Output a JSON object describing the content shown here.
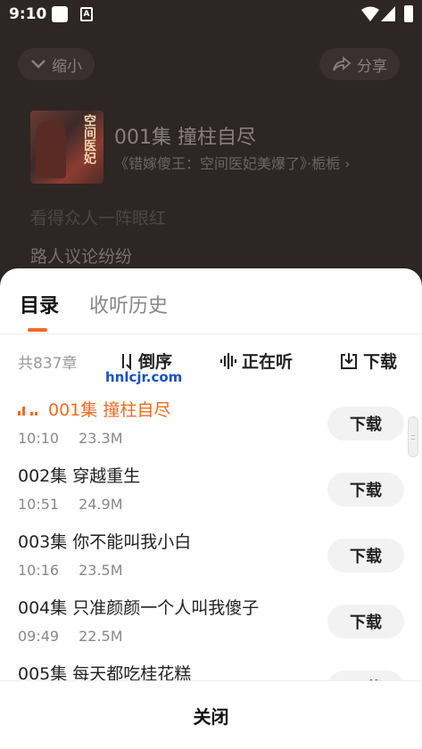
{
  "status_bar": {
    "time": "9:10",
    "notification_icon_letter": "A"
  },
  "player": {
    "collapse_label": "缩小",
    "share_label": "分享",
    "episode_title": "001集 撞柱自尽",
    "book_title": "《错嫁傻王：空间医妃美爆了》·栀栀",
    "cover_text": "空间医妃",
    "lyric_prev": "看得众人一阵眼红",
    "lyric_current": "路人议论纷纷"
  },
  "sheet": {
    "tabs": [
      {
        "label": "目录"
      },
      {
        "label": "收听历史"
      }
    ],
    "chapter_count": "共837章",
    "sort_label": "倒序",
    "playing_label": "正在听",
    "download_label": "下载",
    "watermark": "hnlcjr.com",
    "episodes": [
      {
        "title": "001集 撞柱自尽",
        "duration": "10:10",
        "size": "23.3M",
        "download_label": "下载"
      },
      {
        "title": "002集 穿越重生",
        "duration": "10:51",
        "size": "24.9M",
        "download_label": "下载"
      },
      {
        "title": "003集 你不能叫我小白",
        "duration": "10:16",
        "size": "23.5M",
        "download_label": "下载"
      },
      {
        "title": "004集 只准颜颜一个人叫我傻子",
        "duration": "09:49",
        "size": "22.5M",
        "download_label": "下载"
      },
      {
        "title": "005集 每天都吃桂花糕",
        "download_label": "下载"
      }
    ],
    "close_label": "关闭"
  },
  "colors": {
    "accent": "#f06a22",
    "overlay_bg": "#2e2525"
  }
}
